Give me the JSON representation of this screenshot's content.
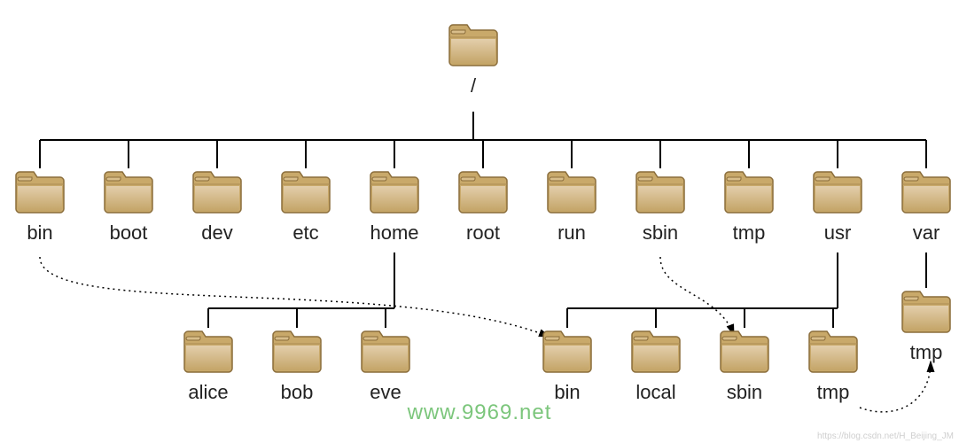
{
  "diagram": {
    "root_label": "/",
    "level1": [
      "bin",
      "boot",
      "dev",
      "etc",
      "home",
      "root",
      "run",
      "sbin",
      "tmp",
      "usr",
      "var"
    ],
    "home_children": [
      "alice",
      "bob",
      "eve"
    ],
    "usr_children": [
      "bin",
      "local",
      "sbin",
      "tmp"
    ],
    "var_children": [
      "tmp"
    ],
    "links": [
      {
        "from": "bin",
        "to": "usr/bin",
        "style": "dotted-arrow"
      },
      {
        "from": "sbin",
        "to": "usr/sbin",
        "style": "dotted-arrow"
      },
      {
        "from": "tmp",
        "to": "var/tmp",
        "style": "dotted-arrow"
      }
    ]
  },
  "watermark": "www.9969.net",
  "source_url": "https://blog.csdn.net/H_Beijing_JM"
}
